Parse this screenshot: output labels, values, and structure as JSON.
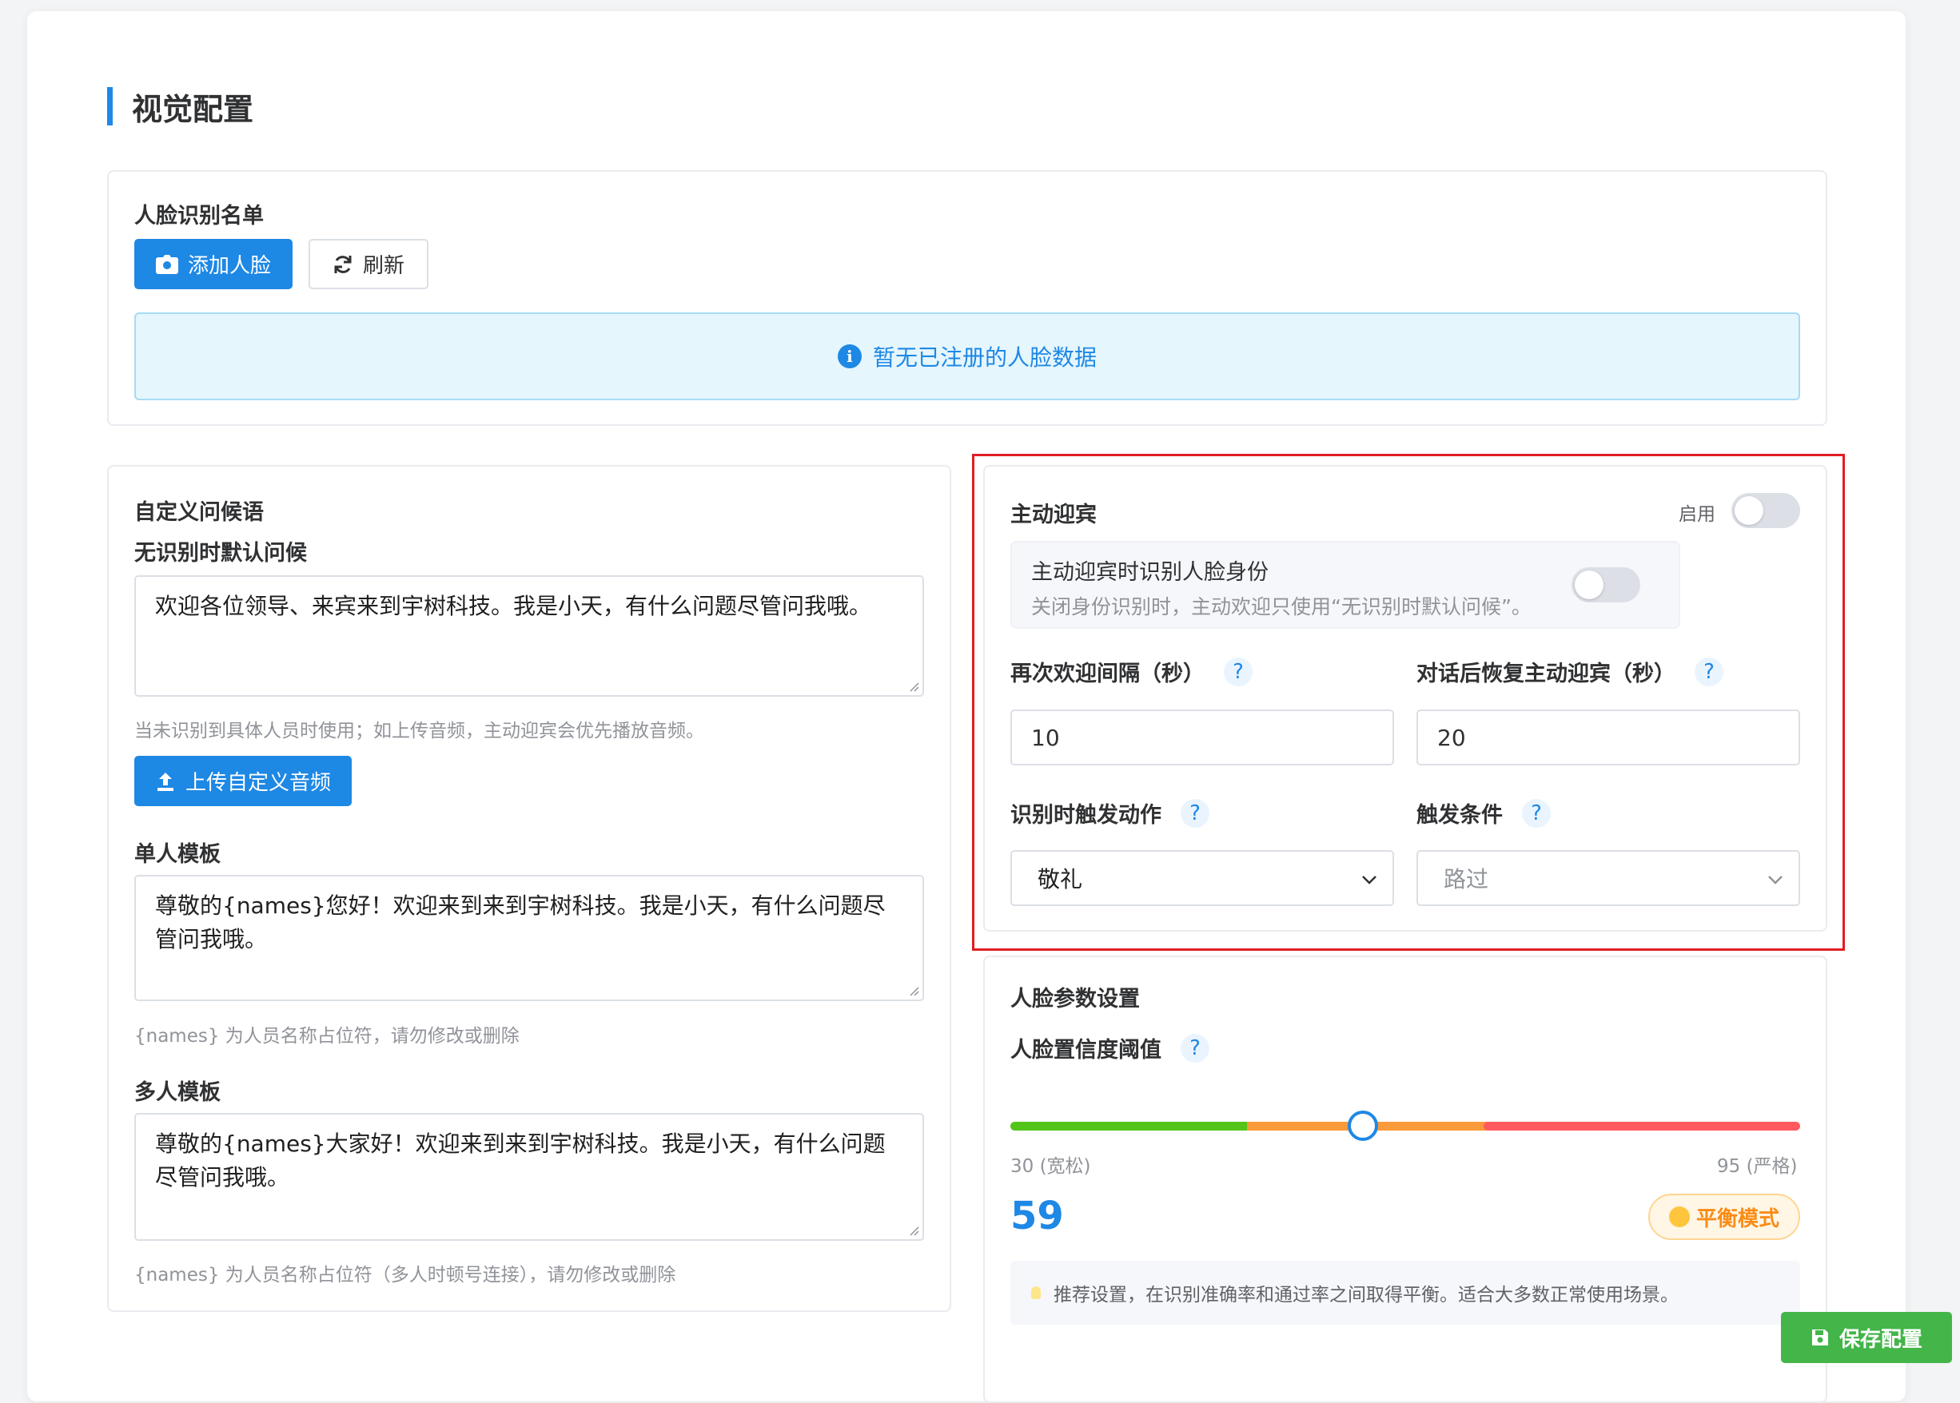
{
  "page": {
    "title": "视觉配置"
  },
  "face_list": {
    "heading": "人脸识别名单",
    "add_button": "添加人脸",
    "refresh_button": "刷新",
    "empty_message": "暂无已注册的人脸数据"
  },
  "greeting": {
    "heading": "自定义问候语",
    "default_label": "无识别时默认问候",
    "default_text": "欢迎各位领导、来宾来到宇树科技。我是小天，有什么问题尽管问我哦。",
    "default_hint": "当未识别到具体人员时使用；如上传音频，主动迎宾会优先播放音频。",
    "upload_button": "上传自定义音频",
    "single_label": "单人模板",
    "single_text": "尊敬的{names}您好！欢迎来到来到宇树科技。我是小天，有什么问题尽管问我哦。",
    "single_hint": "{names} 为人员名称占位符，请勿修改或删除",
    "multi_label": "多人模板",
    "multi_text": "尊敬的{names}大家好！欢迎来到来到宇树科技。我是小天，有什么问题尽管问我哦。",
    "multi_hint": "{names} 为人员名称占位符（多人时顿号连接），请勿修改或删除"
  },
  "welcome": {
    "heading": "主动迎宾",
    "enable_label": "启用",
    "enabled": false,
    "identify_title": "主动迎宾时识别人脸身份",
    "identify_desc": "关闭身份识别时，主动欢迎只使用“无识别时默认问候”。",
    "identify_enabled": false,
    "interval_label": "再次欢迎间隔（秒）",
    "interval_value": "10",
    "resume_label": "对话后恢复主动迎宾（秒）",
    "resume_value": "20",
    "action_label": "识别时触发动作",
    "action_value": "敬礼",
    "condition_label": "触发条件",
    "condition_value": "路过",
    "help_glyph": "?"
  },
  "face_params": {
    "heading": "人脸参数设置",
    "threshold_label": "人脸置信度阈值",
    "min_label": "30 (宽松)",
    "max_label": "95 (严格)",
    "min": 30,
    "max": 95,
    "value": "59",
    "mode_label": "平衡模式",
    "tip": "推荐设置，在识别准确率和通过率之间取得平衡。适合大多数正常使用场景。",
    "colors": {
      "low": "#52c41a",
      "mid": "#fa9a3a",
      "high": "#ff5a5f"
    }
  },
  "footer": {
    "save_button": "保存配置"
  },
  "theme": {
    "accent": "#1e88e5",
    "success": "#43b549",
    "highlight": "#e11d23"
  }
}
